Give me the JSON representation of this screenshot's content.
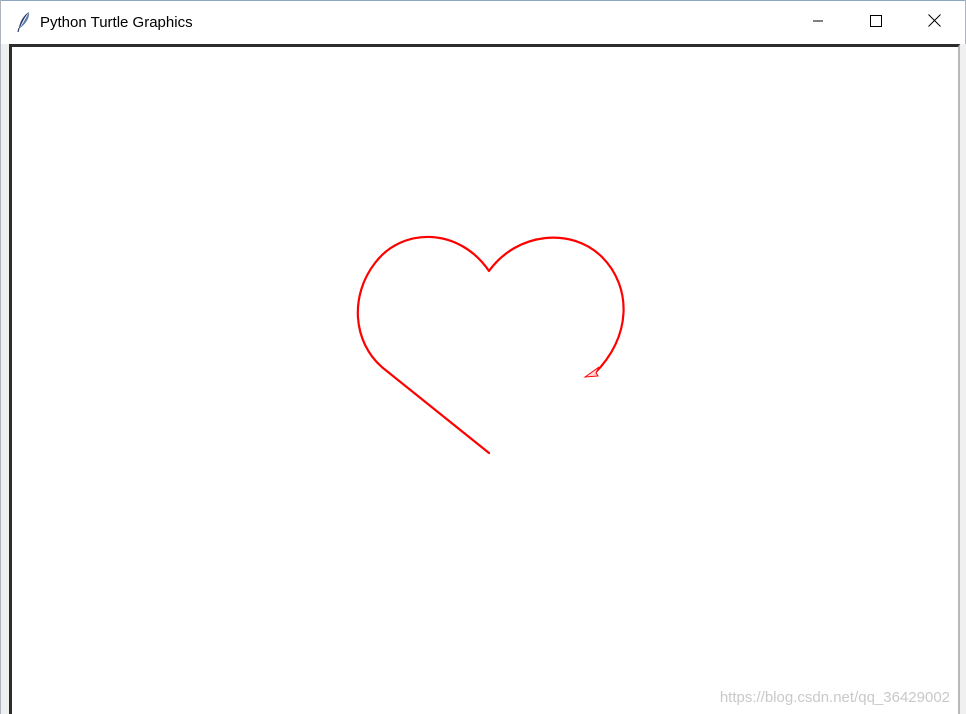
{
  "window": {
    "title": "Python Turtle Graphics",
    "app_icon": "feather-icon",
    "controls": {
      "minimize_icon": "minimize-icon",
      "maximize_icon": "maximize-icon",
      "close_icon": "close-icon"
    }
  },
  "canvas": {
    "background": "#ffffff",
    "pen_color": "#ff0000",
    "turtle_shape": "classic-arrow",
    "drawing": "heart outline"
  },
  "watermark": "https://blog.csdn.net/qq_36429002"
}
